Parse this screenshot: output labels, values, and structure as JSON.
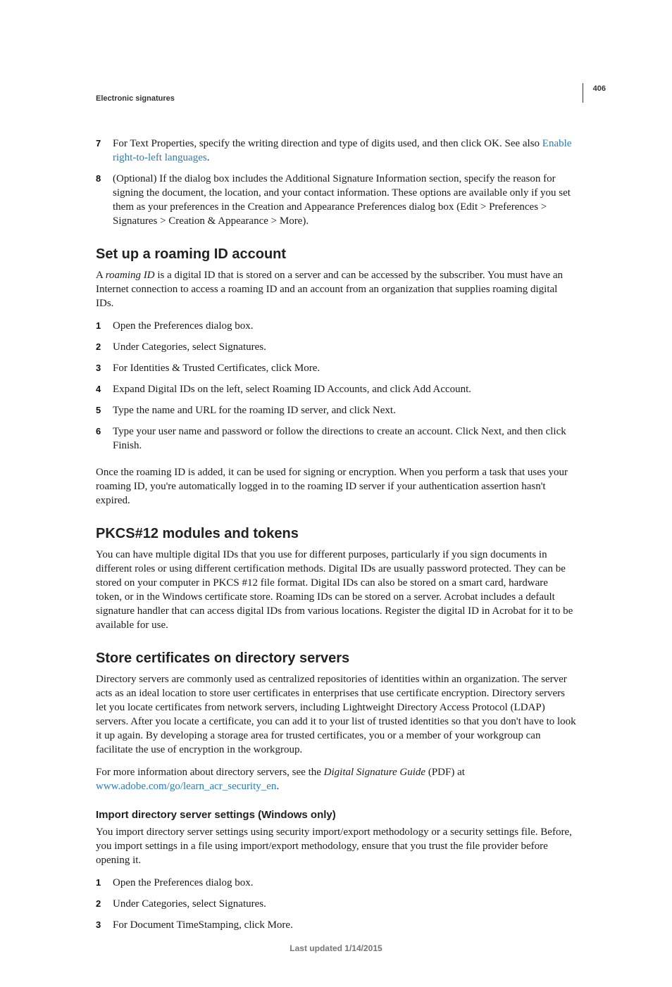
{
  "page_number": "406",
  "breadcrumb": "Electronic signatures",
  "top_steps": [
    {
      "n": "7",
      "html": "For Text Properties, specify the writing direction and type of digits used, and then click OK. See also <a class='link' data-name='link-enable-rtl' data-interactable='true'>Enable right-to-left languages</a>."
    },
    {
      "n": "8",
      "text": "(Optional) If the dialog box includes the Additional Signature Information section, specify the reason for signing the document, the location, and your contact information. These options are available only if you set them as your preferences in the Creation and Appearance Preferences dialog box (Edit > Preferences > Signatures > Creation & Appearance > More)."
    }
  ],
  "sections": {
    "roaming": {
      "title": "Set up a roaming ID account",
      "intro_html": "A <span class='italic'>roaming ID</span> is a digital ID that is stored on a server and can be accessed by the subscriber. You must have an Internet connection to access a roaming ID and an account from an organization that supplies roaming digital IDs.",
      "steps": [
        {
          "n": "1",
          "text": "Open the Preferences dialog box."
        },
        {
          "n": "2",
          "text": "Under Categories, select Signatures."
        },
        {
          "n": "3",
          "text": "For Identities & Trusted Certificates, click More."
        },
        {
          "n": "4",
          "text": "Expand Digital IDs on the left, select Roaming ID Accounts, and click Add Account."
        },
        {
          "n": "5",
          "text": "Type the name and URL for the roaming ID server, and click Next."
        },
        {
          "n": "6",
          "text": "Type your user name and password or follow the directions to create an account. Click Next, and then click Finish."
        }
      ],
      "outro": "Once the roaming ID is added, it can be used for signing or encryption. When you perform a task that uses your roaming ID, you're automatically logged in to the roaming ID server if your authentication assertion hasn't expired."
    },
    "pkcs": {
      "title": "PKCS#12 modules and tokens",
      "body": "You can have multiple digital IDs that you use for different purposes, particularly if you sign documents in different roles or using different certification methods. Digital IDs are usually password protected. They can be stored on your computer in PKCS #12 file format. Digital IDs can also be stored on a smart card, hardware token, or in the Windows certificate store. Roaming IDs can be stored on a server. Acrobat includes a default signature handler that can access digital IDs from various locations. Register the digital ID in Acrobat for it to be available for use."
    },
    "store": {
      "title": "Store certificates on directory servers",
      "body": "Directory servers are commonly used as centralized repositories of identities within an organization. The server acts as an ideal location to store user certificates in enterprises that use certificate encryption. Directory servers let you locate certificates from network servers, including Lightweight Directory Access Protocol (LDAP) servers. After you locate a certificate, you can add it to your list of trusted identities so that you don't have to look it up again. By developing a storage area for trusted certificates, you or a member of your workgroup can facilitate the use of encryption in the workgroup.",
      "more_html": "For more information about directory servers, see the <span class='italic'>Digital Signature Guide</span> (PDF) at <a class='link' data-name='link-acr-security' data-interactable='true'>www.adobe.com/go/learn_acr_security_en</a>.",
      "sub": {
        "title": "Import directory server settings (Windows only)",
        "body": "You import directory server settings using security import/export methodology or a security settings file. Before, you import settings in a file using import/export methodology, ensure that you trust the file provider before opening it.",
        "steps": [
          {
            "n": "1",
            "text": "Open the Preferences dialog box."
          },
          {
            "n": "2",
            "text": "Under Categories, select Signatures."
          },
          {
            "n": "3",
            "text": "For Document TimeStamping, click More."
          }
        ]
      }
    }
  },
  "footer": "Last updated 1/14/2015"
}
